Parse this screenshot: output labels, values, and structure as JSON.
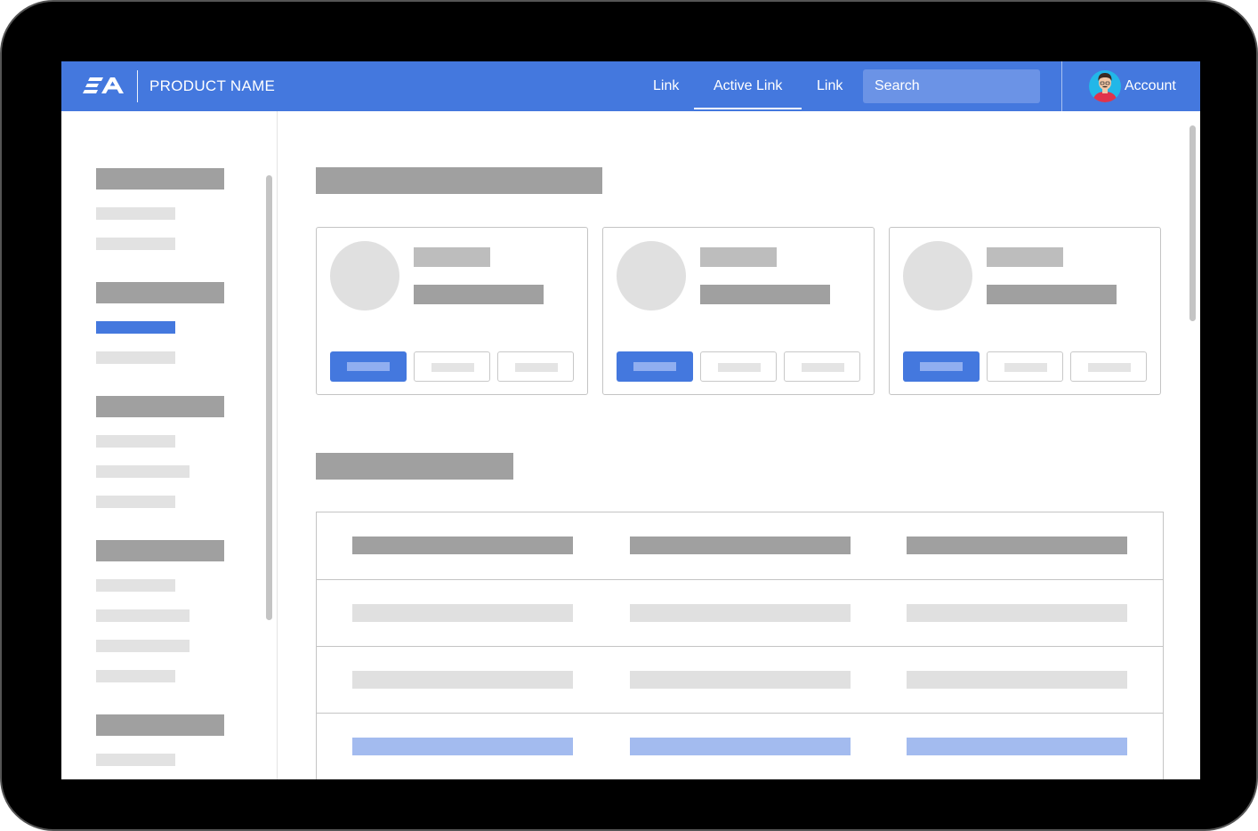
{
  "header": {
    "product_name": "PRODUCT NAME",
    "logo_text": "EA",
    "nav": [
      {
        "label": "Link",
        "active": false
      },
      {
        "label": "Active Link",
        "active": true
      },
      {
        "label": "Link",
        "active": false
      }
    ],
    "search_placeholder": "Search",
    "account_label": "Account"
  },
  "colors": {
    "brand": "#4478de",
    "search_bg": "#6b93e6",
    "selected_item": "#4478de",
    "highlight_row": "#a3bbef",
    "header_cell": "#a0a0a0",
    "body_cell": "#e0e0e0",
    "avatar_bg": "#22b7e8",
    "avatar_shirt": "#e0334b"
  },
  "icons": {
    "logo": "ea-logo-icon",
    "avatar": "user-avatar-icon"
  },
  "sidebar": {
    "groups": [
      {
        "items": [
          {
            "selected": false
          },
          {
            "selected": false
          }
        ]
      },
      {
        "items": [
          {
            "selected": true
          },
          {
            "selected": false
          }
        ]
      },
      {
        "items": [
          {
            "selected": false
          },
          {
            "selected": false
          },
          {
            "selected": false
          }
        ]
      },
      {
        "items": [
          {
            "selected": false
          },
          {
            "selected": false
          },
          {
            "selected": false
          },
          {
            "selected": false
          }
        ]
      },
      {
        "items": [
          {
            "selected": false
          }
        ]
      }
    ]
  },
  "main": {
    "cards": [
      {
        "actions": [
          "primary",
          "secondary",
          "secondary"
        ]
      },
      {
        "actions": [
          "primary",
          "secondary",
          "secondary"
        ]
      },
      {
        "actions": [
          "primary",
          "secondary",
          "secondary"
        ]
      }
    ],
    "table": {
      "columns": 3,
      "rows": [
        "header",
        "body",
        "body",
        "highlighted"
      ]
    }
  }
}
